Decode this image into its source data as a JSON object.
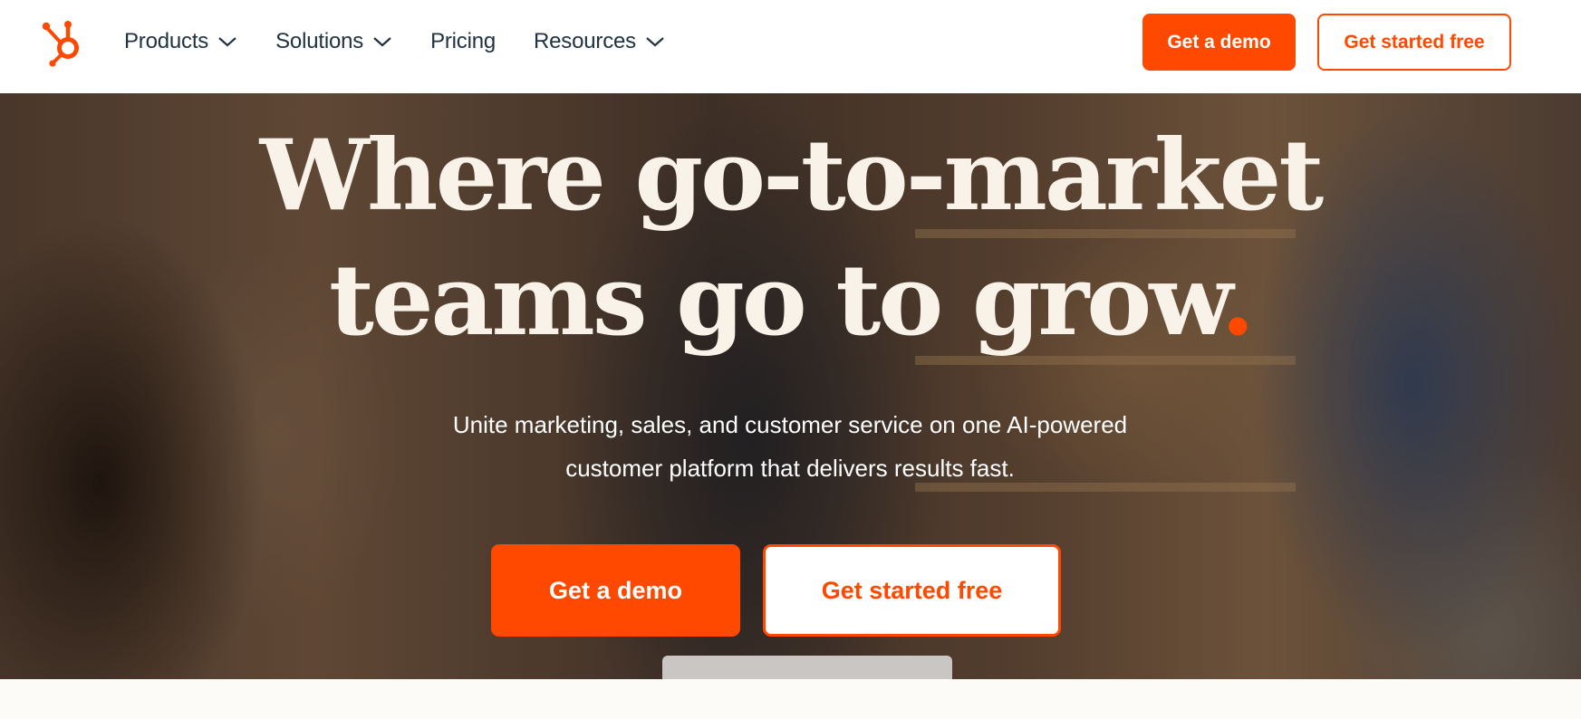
{
  "header": {
    "logo": {
      "icon": "hubspot-sprocket-icon",
      "color": "#ff4800"
    },
    "nav": [
      {
        "label": "Products",
        "has_dropdown": true
      },
      {
        "label": "Solutions",
        "has_dropdown": true
      },
      {
        "label": "Pricing",
        "has_dropdown": false
      },
      {
        "label": "Resources",
        "has_dropdown": true
      }
    ],
    "demo_button": "Get a demo",
    "start_button": "Get started free"
  },
  "hero": {
    "headline_line1": "Where go-to-market",
    "headline_line2": "teams go to grow",
    "headline_dot": ".",
    "subhead_line1": "Unite marketing, sales, and customer service on one AI-powered",
    "subhead_line2": "customer platform that delivers results fast.",
    "demo_button": "Get a demo",
    "start_button": "Get started free"
  },
  "colors": {
    "accent": "#ff4800",
    "text_dark": "#213343",
    "headline": "#f8f2e8"
  }
}
